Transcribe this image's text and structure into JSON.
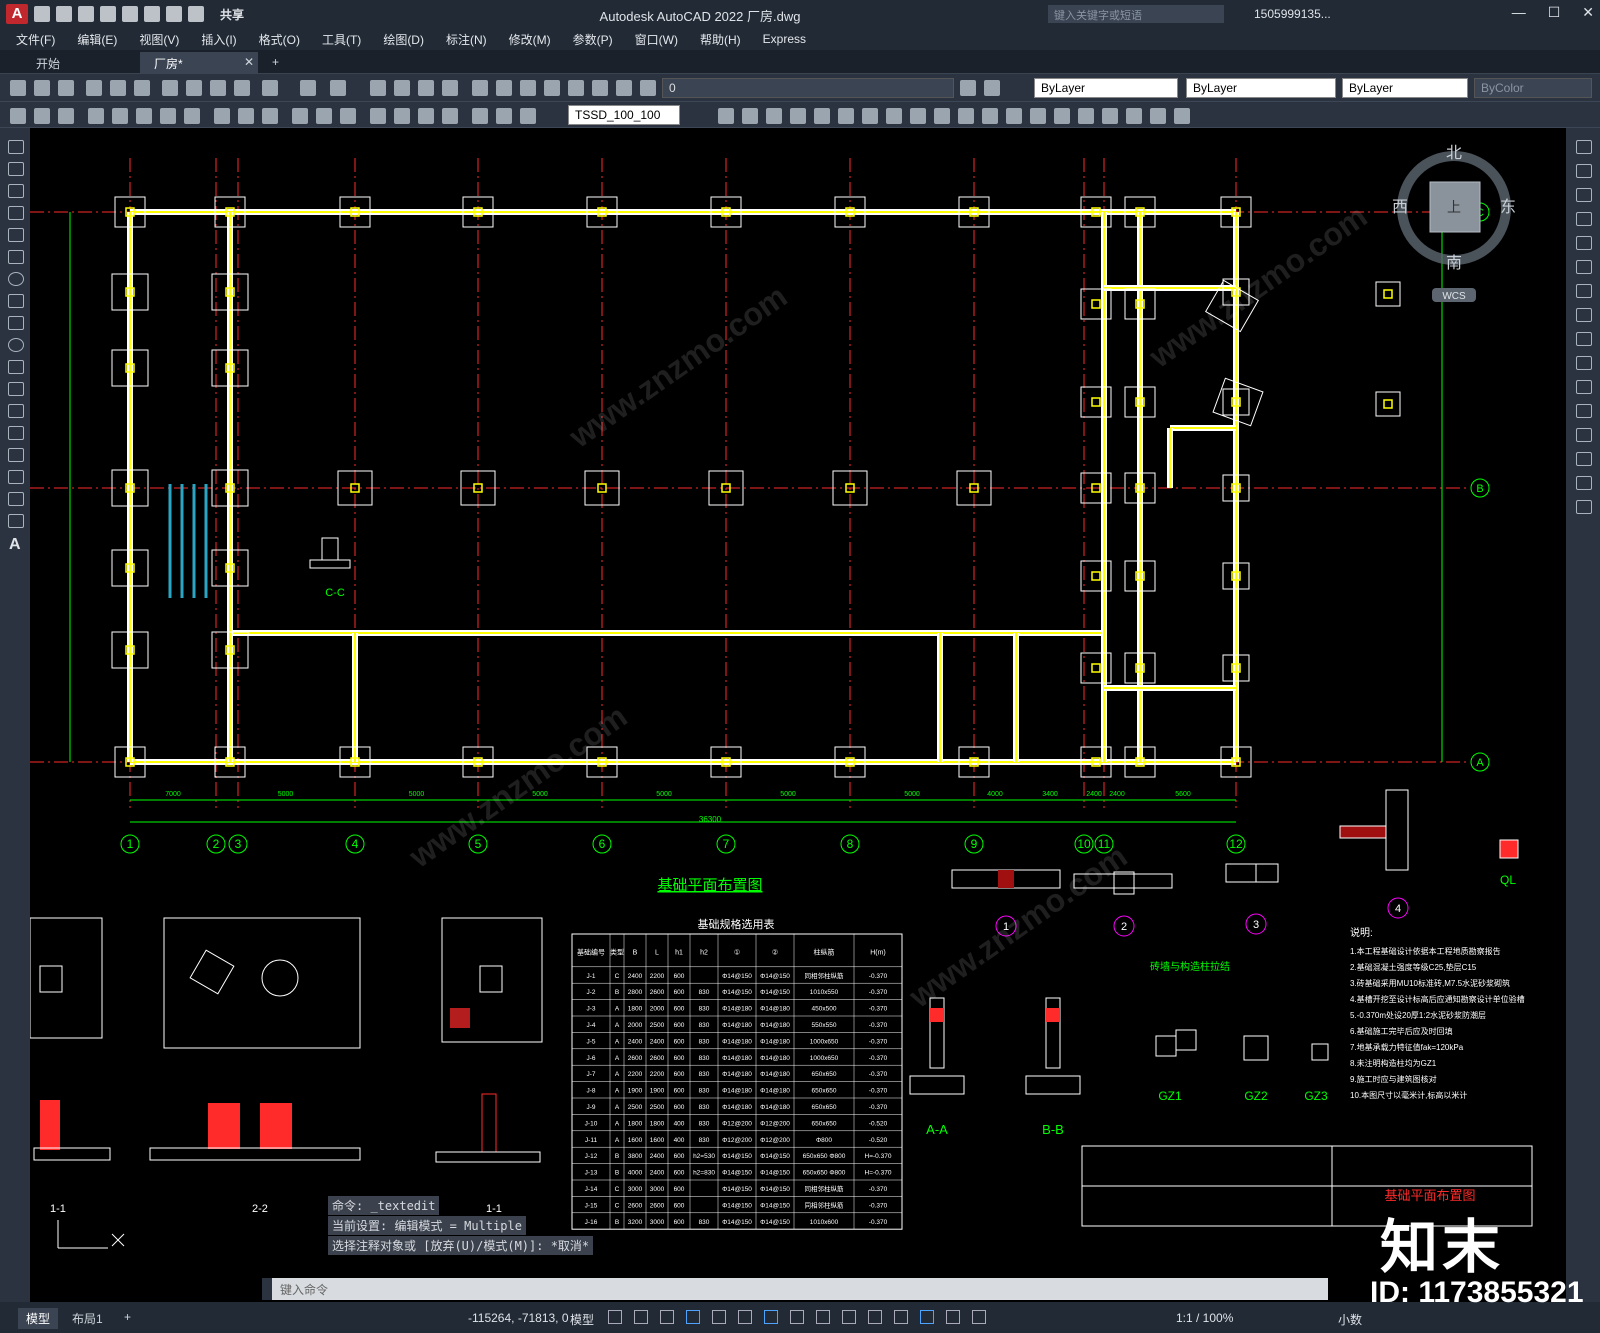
{
  "app": {
    "title": "Autodesk AutoCAD 2022    厂房.dwg",
    "logo": "A",
    "share": "共享",
    "search_placeholder": "键入关键字或短语",
    "user": "1505999135...",
    "window_buttons": [
      "—",
      "☐",
      "✕"
    ]
  },
  "menu": [
    "文件(F)",
    "编辑(E)",
    "视图(V)",
    "插入(I)",
    "格式(O)",
    "工具(T)",
    "绘图(D)",
    "标注(N)",
    "修改(M)",
    "参数(P)",
    "窗口(W)",
    "帮助(H)",
    "Express"
  ],
  "tabs": [
    {
      "label": "开始"
    },
    {
      "label": "厂房*"
    }
  ],
  "toolbar": {
    "layer": "0",
    "color": "ByLayer",
    "linetype": "ByLayer",
    "lineweight": "ByLayer",
    "plotstyle": "ByColor",
    "textstyle": "TSSD_100_100"
  },
  "viewcube": {
    "north": "北",
    "south": "南",
    "east": "东",
    "west": "西",
    "top": "上",
    "wcs": "WCS"
  },
  "drawing": {
    "grid_cols": [
      "1",
      "2",
      "3",
      "4",
      "5",
      "6",
      "7",
      "8",
      "9",
      "10",
      "11",
      "12"
    ],
    "grid_rows": [
      "A",
      "B",
      "C"
    ],
    "plan_title": "基础平面布置图",
    "section_cc": "C-C",
    "total_dim": "36300",
    "dims_bottom": [
      "7000",
      "5000",
      "5000",
      "5000",
      "5000",
      "5000",
      "5000",
      "4000",
      "3400",
      "2400",
      "2400",
      "5600"
    ],
    "details": [
      "1",
      "2",
      "3",
      "4"
    ],
    "ql": "QL",
    "sections": [
      "A-A",
      "B-B"
    ],
    "gz": [
      "GZ1",
      "GZ2",
      "GZ3"
    ],
    "left_sections": [
      "2-2",
      "1-1",
      "1-1"
    ],
    "brick_title": "砖墙与构造柱拉结",
    "notes_title": "说明:",
    "notes": [
      "1.本工程基础设计依据本工程地质勘察报告",
      "2.基础混凝土强度等级C25,垫层C15",
      "3.砖基础采用MU10标准砖,M7.5水泥砂浆砌筑",
      "4.基槽开挖至设计标高后应通知勘察设计单位验槽",
      "5.-0.370m处设20厚1:2水泥砂浆防潮层",
      "6.基础施工完毕后应及时回填",
      "7.地基承载力特征值fak=120kPa",
      "8.未注明构造柱均为GZ1",
      "9.施工时应与建筑图核对",
      "10.本图尺寸以毫米计,标高以米计"
    ],
    "title_block": "基础平面布置图",
    "table": {
      "title": "基础规格选用表",
      "headers": [
        "基础编号",
        "类型",
        "B",
        "L",
        "h1",
        "h2",
        "①",
        "②",
        "柱纵筋",
        "H(m)"
      ],
      "rows": [
        [
          "J-1",
          "C",
          "2400",
          "2200",
          "600",
          "",
          "Φ14@150",
          "Φ14@150",
          "同相邻柱纵筋",
          "-0.370"
        ],
        [
          "J-2",
          "B",
          "2800",
          "2600",
          "600",
          "830",
          "Φ14@150",
          "Φ14@150",
          "1010x550",
          "-0.370"
        ],
        [
          "J-3",
          "A",
          "1800",
          "2000",
          "600",
          "830",
          "Φ14@180",
          "Φ14@180",
          "450x500",
          "-0.370"
        ],
        [
          "J-4",
          "A",
          "2000",
          "2500",
          "600",
          "830",
          "Φ14@180",
          "Φ14@180",
          "550x550",
          "-0.370"
        ],
        [
          "J-5",
          "A",
          "2400",
          "2400",
          "600",
          "830",
          "Φ14@180",
          "Φ14@180",
          "1000x650",
          "-0.370"
        ],
        [
          "J-6",
          "A",
          "2600",
          "2600",
          "600",
          "830",
          "Φ14@180",
          "Φ14@180",
          "1000x650",
          "-0.370"
        ],
        [
          "J-7",
          "A",
          "2200",
          "2200",
          "600",
          "830",
          "Φ14@180",
          "Φ14@180",
          "650x650",
          "-0.370"
        ],
        [
          "J-8",
          "A",
          "1900",
          "1900",
          "600",
          "830",
          "Φ14@180",
          "Φ14@180",
          "650x650",
          "-0.370"
        ],
        [
          "J-9",
          "A",
          "2500",
          "2500",
          "600",
          "830",
          "Φ14@180",
          "Φ14@180",
          "650x650",
          "-0.370"
        ],
        [
          "J-10",
          "A",
          "1800",
          "1800",
          "400",
          "830",
          "Φ12@200",
          "Φ12@200",
          "650x650",
          "-0.520"
        ],
        [
          "J-11",
          "A",
          "1600",
          "1600",
          "400",
          "830",
          "Φ12@200",
          "Φ12@200",
          "Φ800",
          "-0.520"
        ],
        [
          "J-12",
          "B",
          "3800",
          "2400",
          "600",
          "h2=530",
          "Φ14@150",
          "Φ14@150",
          "650x650 Φ800",
          "H=-0.370"
        ],
        [
          "J-13",
          "B",
          "4000",
          "2400",
          "600",
          "h2=830",
          "Φ14@150",
          "Φ14@150",
          "650x650 Φ800",
          "H=-0.370"
        ],
        [
          "J-14",
          "C",
          "3000",
          "3000",
          "600",
          "",
          "Φ14@150",
          "Φ14@150",
          "同相邻柱纵筋",
          "-0.370"
        ],
        [
          "J-15",
          "C",
          "2600",
          "2600",
          "600",
          "",
          "Φ14@150",
          "Φ14@150",
          "同相邻柱纵筋",
          "-0.370"
        ],
        [
          "J-16",
          "B",
          "3200",
          "3000",
          "600",
          "830",
          "Φ14@150",
          "Φ14@150",
          "1010x600",
          "-0.370"
        ]
      ]
    }
  },
  "command": {
    "line1": "命令: _textedit",
    "line2": "当前设置: 编辑模式 = Multiple",
    "line3": "选择注释对象或 [放弃(U)/模式(M)]: *取消*",
    "placeholder": "键入命令"
  },
  "status": {
    "tabs": [
      "模型",
      "布局1",
      "+"
    ],
    "coords": "-115264, -71813, 0",
    "mode": "模型",
    "scale": "1:1 / 100%",
    "units": "小数"
  },
  "watermark": {
    "site": "www.znzmo.com",
    "brand": "知末",
    "id": "ID: 1173855321"
  },
  "colors": {
    "bg": "#000000",
    "grid": "#ff2a2a",
    "dim": "#00ff00",
    "footing": "#ffffff",
    "beam": "#ffff00",
    "magenta": "#ff00ff"
  }
}
